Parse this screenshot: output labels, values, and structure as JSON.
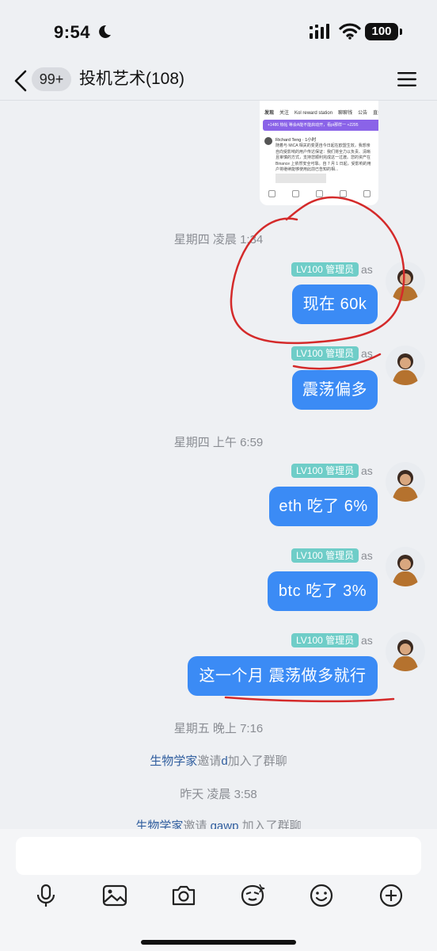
{
  "status_bar": {
    "time": "9:54",
    "battery": "100"
  },
  "header": {
    "unread_badge": "99+",
    "title": "投机艺术(108)"
  },
  "shared_screenshot": {
    "tabs": [
      "发现",
      "关注",
      "Kol reward station",
      "聊聊钱",
      "公告",
      "直播"
    ],
    "banner": "+1486 热帖 等会A能不能启动开，看pi那样一 +2295",
    "author": "Richard Teng · 1小时",
    "body": "随着与 MiCA 相关的变更自今日起在欧盟生效，我想亲自向受影响的用户传达保证：我们将全力以负责、清晰且审慎的方式，支持您顺利完成这一过渡。您的资产在 Binance 上依然安全可靠。自 7 月 1 日起，受影响的用户将继续能够使用此前已告知的相..."
  },
  "messages": [
    {
      "time": "星期四 凌晨 1:34"
    },
    {
      "badge": "LV100 管理员",
      "sender": "as",
      "text": "现在 60k"
    },
    {
      "badge": "LV100 管理员",
      "sender": "as",
      "text": "震荡偏多"
    },
    {
      "time": "星期四 上午 6:59"
    },
    {
      "badge": "LV100 管理员",
      "sender": "as",
      "text": "eth 吃了 6%"
    },
    {
      "badge": "LV100 管理员",
      "sender": "as",
      "text": "btc 吃了 3%"
    },
    {
      "badge": "LV100 管理员",
      "sender": "as",
      "text": "这一个月 震荡做多就行"
    },
    {
      "time": "星期五 晚上 7:16"
    },
    {
      "system": {
        "actor": "生物学家",
        "verb": "邀请",
        "target": "d",
        "rest": "加入了群聊"
      }
    },
    {
      "time": "昨天 凌晨 3:58"
    },
    {
      "system": {
        "actor": "生物学家",
        "verb": "邀请 ",
        "target": "gawp",
        "rest": " 加入了群聊"
      }
    }
  ],
  "toolbar": [
    "microphone-icon",
    "image-icon",
    "camera-icon",
    "sticker-icon",
    "emoji-icon",
    "plus-icon"
  ],
  "colors": {
    "bubble": "#3b8bf5",
    "badge": "#6fcdc8",
    "link": "#2f5d9e",
    "annotation": "#d42a2a"
  }
}
